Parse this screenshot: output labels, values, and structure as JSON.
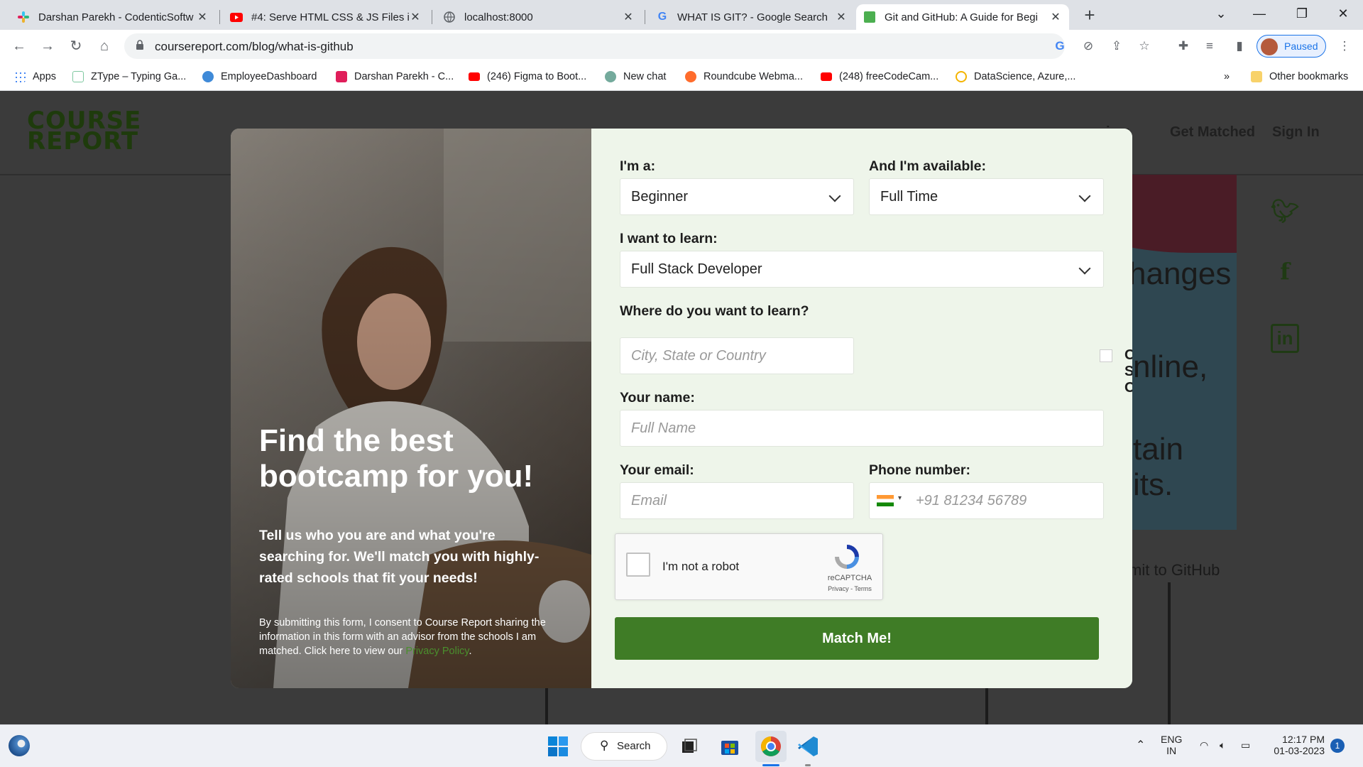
{
  "browser": {
    "tabs": [
      {
        "title": "Darshan Parekh - CodenticSoftw",
        "favicon": "slack-icon",
        "color": "#e01e5a"
      },
      {
        "title": "#4: Serve HTML CSS & JS Files in",
        "favicon": "youtube-icon",
        "color": "#ff0000"
      },
      {
        "title": "localhost:8000",
        "favicon": "globe-icon",
        "color": "#5f6368"
      },
      {
        "title": "WHAT IS GIT? - Google Search",
        "favicon": "google-icon",
        "color": "#4285f4"
      },
      {
        "title": "Git and GitHub: A Guide for Begi",
        "favicon": "course-report-icon",
        "color": "#4caf50"
      }
    ],
    "url": "coursereport.com/blog/what-is-github",
    "profile_status": "Paused",
    "bookmarks": [
      {
        "label": "Apps",
        "icon": "apps-grid-icon",
        "color": "#4285f4"
      },
      {
        "label": "ZType – Typing Ga...",
        "icon": "ztype-icon",
        "color": "#7ec8a0"
      },
      {
        "label": "EmployeeDashboard",
        "icon": "dashboard-icon",
        "color": "#3f8ad8"
      },
      {
        "label": "Darshan Parekh - C...",
        "icon": "slack-icon",
        "color": "#e01e5a"
      },
      {
        "label": "(246) Figma to Boot...",
        "icon": "youtube-icon",
        "color": "#ff0000"
      },
      {
        "label": "New chat",
        "icon": "openai-icon",
        "color": "#74aa9c"
      },
      {
        "label": "Roundcube Webma...",
        "icon": "cpanel-icon",
        "color": "#ff6c2c"
      },
      {
        "label": "(248) freeCodeCam...",
        "icon": "youtube-icon",
        "color": "#ff0000"
      },
      {
        "label": "DataScience, Azure,...",
        "icon": "sync-icon",
        "color": "#f4b400"
      }
    ],
    "other_bookmarks": "Other bookmarks",
    "overflow": "»"
  },
  "page": {
    "logo_line1": "COURSE",
    "logo_line2": "REPORT",
    "nav": [
      "iew",
      "Get Matched",
      "Sign In"
    ],
    "hero_fragments": [
      "hanges",
      "nline,",
      "tain",
      "its."
    ],
    "commit_text": "mit to GitHub"
  },
  "modal": {
    "headline": "Find the best bootcamp for you!",
    "subtext": "Tell us who you are and what you're searching for. We'll match you with highly-rated schools that fit your needs!",
    "consent": "By submitting this form, I consent to Course Report sharing the information in this form with an advisor from the schools I am matched. Click here to view our",
    "consent_link": "Privacy Policy",
    "consent_end": ".",
    "close_symbol": "✕",
    "form": {
      "role_label": "I'm a:",
      "role_value": "Beginner",
      "availability_label": "And I'm available:",
      "availability_value": "Full Time",
      "learn_label": "I want to learn:",
      "learn_value": "Full Stack Developer",
      "location_label": "Where do you want to learn?",
      "location_placeholder": "City, State or Country",
      "online_label": "Online Schools Only",
      "name_label": "Your name:",
      "name_placeholder": "Full Name",
      "email_label": "Your email:",
      "email_placeholder": "Email",
      "phone_label": "Phone number:",
      "phone_placeholder": "+91 81234 56789",
      "captcha_label": "I'm not a robot",
      "captcha_brand": "reCAPTCHA",
      "captcha_links": "Privacy - Terms",
      "submit": "Match Me!"
    }
  },
  "taskbar": {
    "search": "Search",
    "lang1": "ENG",
    "lang2": "IN",
    "time": "12:17 PM",
    "date": "01-03-2023",
    "notifications": "1"
  },
  "colors": {
    "accent_green": "#3f7c26",
    "brand_dark_green": "#1e3b0c",
    "modal_bg": "#eef5ea"
  }
}
